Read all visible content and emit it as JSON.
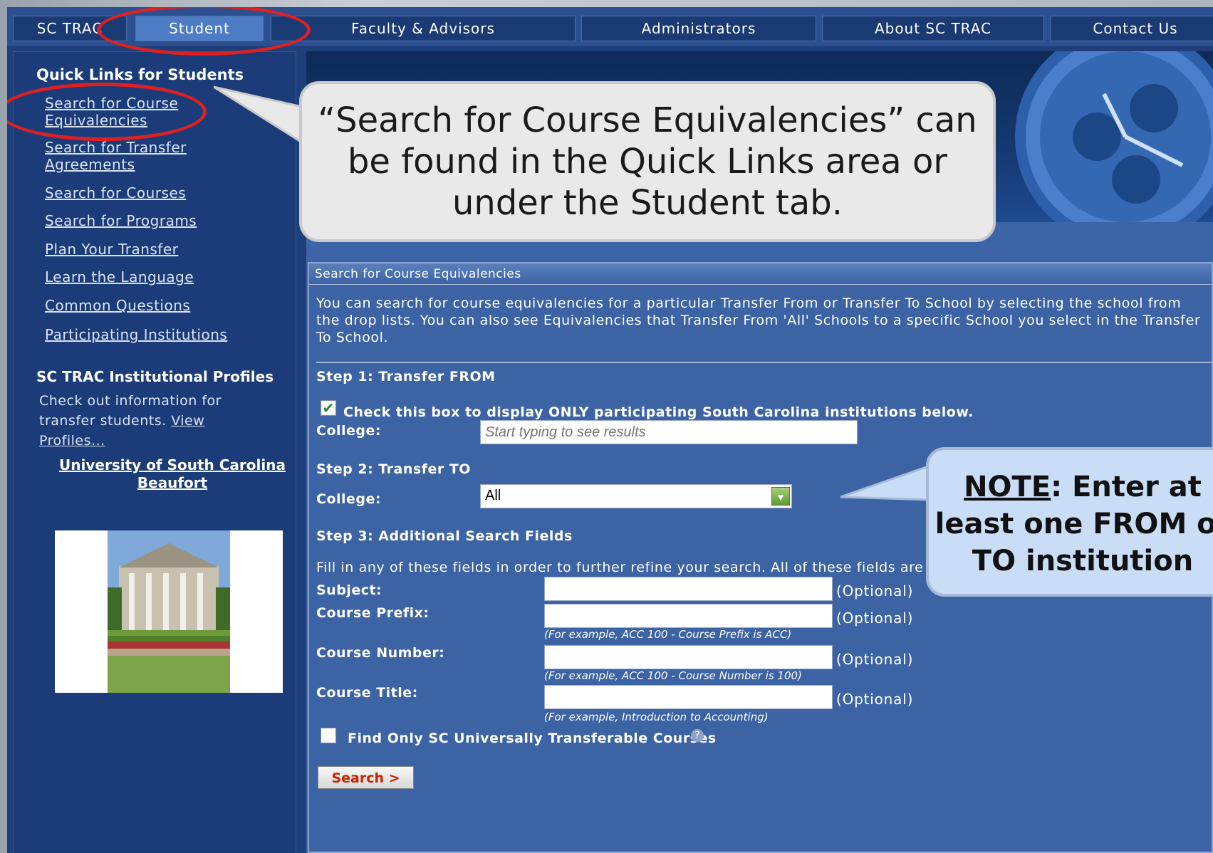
{
  "nav": {
    "tabs": [
      {
        "label": "SC TRAC"
      },
      {
        "label": "Student"
      },
      {
        "label": "Faculty & Advisors"
      },
      {
        "label": "Administrators"
      },
      {
        "label": "About SC TRAC"
      },
      {
        "label": "Contact Us"
      }
    ]
  },
  "sidebar": {
    "quick_links_heading": "Quick Links for Students",
    "links": [
      {
        "label": "Search for Course Equivalencies"
      },
      {
        "label": "Search for Transfer Agreements"
      },
      {
        "label": "Search for Courses"
      },
      {
        "label": "Search for Programs"
      },
      {
        "label": "Plan Your Transfer"
      },
      {
        "label": "Learn the Language"
      },
      {
        "label": "Common Questions"
      },
      {
        "label": "Participating Institutions"
      }
    ],
    "profiles_heading": "SC TRAC Institutional Profiles",
    "profiles_text": "Check out information for transfer students.",
    "profiles_link": "View Profiles...",
    "school_name": "University of South Carolina Beaufort"
  },
  "panel": {
    "title": "Search for Course Equivalencies",
    "description": "You can search for course equivalencies for a particular Transfer From or Transfer To School by selecting the school from the drop lists. You can also see Equivalencies that Transfer From 'All' Schools to a specific School you select in the Transfer To School.",
    "step1": "Step 1: Transfer FROM",
    "sc_only_checkbox_label": "Check this box to display ONLY participating South Carolina institutions below.",
    "college_label": "College:",
    "from_college_placeholder": "Start typing to see results",
    "step2": "Step 2: Transfer TO",
    "to_college_value": "All",
    "step3": "Step 3: Additional Search Fields",
    "step3_note": "Fill in any of these fields in order to further refine your search. All of these fields are optional.",
    "fields": [
      {
        "label": "Subject:",
        "optional": "(Optional)",
        "hint": ""
      },
      {
        "label": "Course Prefix:",
        "optional": "(Optional)",
        "hint": "(For example, ACC 100 - Course Prefix is ACC)"
      },
      {
        "label": "Course Number:",
        "optional": "(Optional)",
        "hint": "(For example, ACC 100 - Course Number is 100)"
      },
      {
        "label": "Course Title:",
        "optional": "(Optional)",
        "hint": "(For example, Introduction to Accounting)"
      }
    ],
    "universal_checkbox_label": "Find Only SC Universally Transferable Courses",
    "search_button": "Search >"
  },
  "callouts": {
    "quick_links_note": "“Search for Course Equivalencies” can be found in the Quick Links area or under the Student tab.",
    "note_prefix": "NOTE",
    "note_text": ": Enter at least one FROM or TO institution"
  },
  "colors": {
    "page_bg": "#1e3f7a",
    "panel_bg": "#3c63a4",
    "highlight_ring": "#e02020",
    "search_text": "#cc2200"
  }
}
